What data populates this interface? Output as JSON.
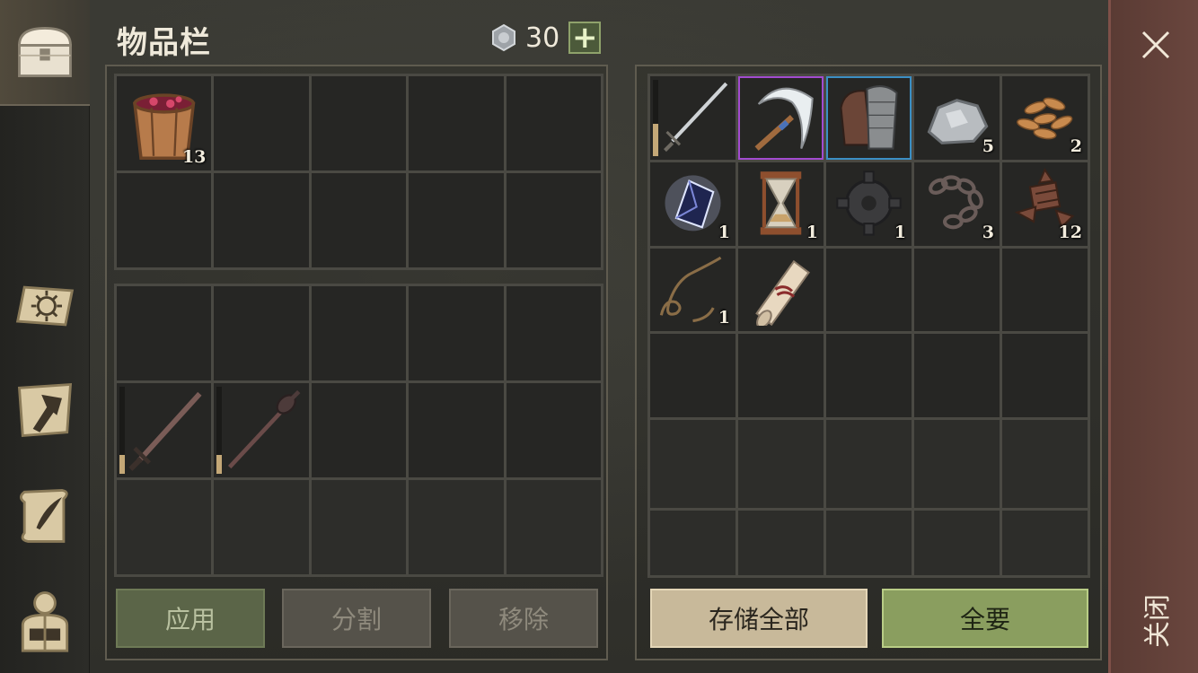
{
  "header": {
    "title": "物品栏",
    "currency_value": "30",
    "currency_icon": "silver-coin-icon",
    "plus_label": "+"
  },
  "rail": {
    "tabs": [
      {
        "icon": "chest-icon",
        "active": true
      },
      {
        "icon": "sun-book-icon",
        "active": false
      },
      {
        "icon": "hammer-map-icon",
        "active": false
      },
      {
        "icon": "quill-scroll-icon",
        "active": false
      },
      {
        "icon": "character-backpack-icon",
        "active": false
      }
    ]
  },
  "inventory_top": {
    "slots": [
      {
        "item": "berry-bucket-icon",
        "count": "13"
      }
    ]
  },
  "inventory_bottom": {
    "slots": [
      {
        "item": "sword-icon",
        "durability": 0.22
      },
      {
        "item": "mace-icon",
        "durability": 0.22
      }
    ]
  },
  "storage": {
    "slots": [
      {
        "item": "long-sword-icon",
        "durability": 0.42
      },
      {
        "item": "sickle-icon",
        "rarity": "purple"
      },
      {
        "item": "gauntlet-icon",
        "rarity": "blue"
      },
      {
        "item": "stone-icon",
        "count": "5"
      },
      {
        "item": "seeds-icon",
        "count": "2"
      },
      {
        "item": "crystal-icon",
        "count": "1"
      },
      {
        "item": "hourglass-icon",
        "count": "1"
      },
      {
        "item": "gear-icon",
        "count": "1"
      },
      {
        "item": "chain-icon",
        "count": "3"
      },
      {
        "item": "scrap-icon",
        "count": "12"
      },
      {
        "item": "rope-icon",
        "count": "1"
      },
      {
        "item": "scroll-icon",
        "count": ""
      }
    ]
  },
  "buttons": {
    "apply": "应用",
    "split": "分割",
    "remove": "移除",
    "store_all": "存储全部",
    "take_all": "全要"
  },
  "close": {
    "label": "关闭"
  },
  "colors": {
    "accent_green": "#8a9e5f",
    "close_strip": "#6a463e",
    "rarity_purple": "#a24bd0",
    "rarity_blue": "#3b8fc4"
  }
}
